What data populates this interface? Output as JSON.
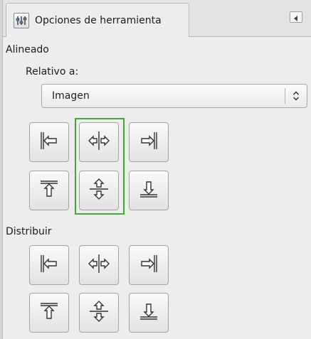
{
  "tab": {
    "title": "Opciones de herramienta",
    "icon": "tool-options-icon",
    "menu_icon": "tab-menu-icon"
  },
  "align": {
    "section_label": "Alineado",
    "relative_label": "Relativo a:",
    "relative_value": "Imagen",
    "buttons": [
      {
        "name": "align-left-edge",
        "icon": "align-left-icon"
      },
      {
        "name": "align-center-horizontal",
        "icon": "align-center-h-icon"
      },
      {
        "name": "align-right-edge",
        "icon": "align-right-icon"
      },
      {
        "name": "align-top-edge",
        "icon": "align-top-icon"
      },
      {
        "name": "align-middle-vertical",
        "icon": "align-middle-v-icon"
      },
      {
        "name": "align-bottom-edge",
        "icon": "align-bottom-icon"
      }
    ],
    "highlight_color": "#3cab2f"
  },
  "distribute": {
    "section_label": "Distribuir",
    "buttons": [
      {
        "name": "distribute-left-edges",
        "icon": "align-left-icon"
      },
      {
        "name": "distribute-centers-horizontal",
        "icon": "align-center-h-icon"
      },
      {
        "name": "distribute-right-edges",
        "icon": "align-right-icon"
      },
      {
        "name": "distribute-top-edges",
        "icon": "align-top-icon"
      },
      {
        "name": "distribute-middles-vertical",
        "icon": "align-middle-v-icon"
      },
      {
        "name": "distribute-bottom-edges",
        "icon": "align-bottom-icon"
      }
    ]
  }
}
